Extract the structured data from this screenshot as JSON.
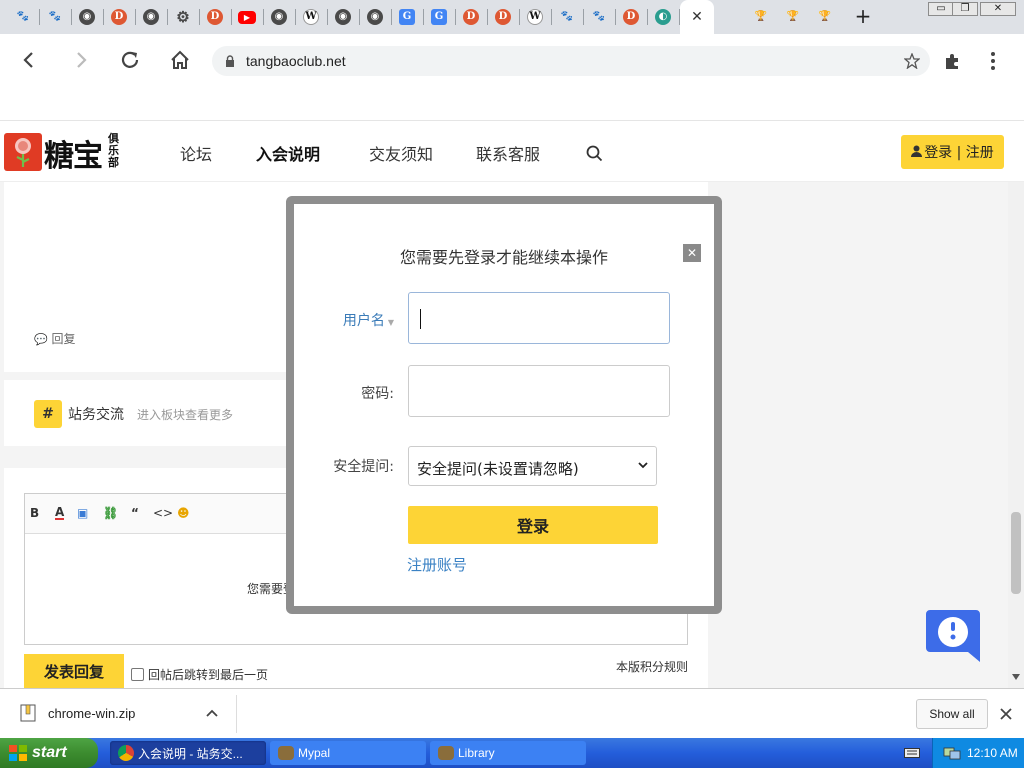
{
  "browser": {
    "tabs": [
      {
        "icon": "baidu-paw-icon",
        "color": "#2e5bd3",
        "glyph": "🐾"
      },
      {
        "icon": "baidu-paw-icon",
        "color": "#2e5bd3",
        "glyph": "🐾"
      },
      {
        "icon": "globe-icon",
        "color": "#4a4a4a",
        "glyph": "◉"
      },
      {
        "icon": "duckduckgo-icon",
        "color": "#de5833",
        "glyph": "D"
      },
      {
        "icon": "globe-icon",
        "color": "#4a4a4a",
        "glyph": "◉"
      },
      {
        "icon": "gear-icon",
        "color": "#4a4a4a",
        "glyph": "⚙"
      },
      {
        "icon": "duckduckgo-icon",
        "color": "#de5833",
        "glyph": "D"
      },
      {
        "icon": "youtube-icon",
        "color": "#ff0000",
        "glyph": "▶"
      },
      {
        "icon": "globe-icon",
        "color": "#4a4a4a",
        "glyph": "◉"
      },
      {
        "icon": "wikipedia-icon",
        "color": "#ffffff",
        "glyph": "W"
      },
      {
        "icon": "globe-icon",
        "color": "#4a4a4a",
        "glyph": "◉"
      },
      {
        "icon": "globe-icon",
        "color": "#4a4a4a",
        "glyph": "◉"
      },
      {
        "icon": "translate-icon",
        "color": "#4285f4",
        "glyph": "G"
      },
      {
        "icon": "translate-icon",
        "color": "#4285f4",
        "glyph": "G"
      },
      {
        "icon": "duckduckgo-icon",
        "color": "#de5833",
        "glyph": "D"
      },
      {
        "icon": "duckduckgo-icon",
        "color": "#de5833",
        "glyph": "D"
      },
      {
        "icon": "wikipedia-icon",
        "color": "#ffffff",
        "glyph": "W"
      },
      {
        "icon": "baidu-paw-icon",
        "color": "#2e5bd3",
        "glyph": "🐾"
      },
      {
        "icon": "baidu-paw-icon",
        "color": "#2e5bd3",
        "glyph": "🐾"
      },
      {
        "icon": "duckduckgo-icon",
        "color": "#de5833",
        "glyph": "D"
      },
      {
        "icon": "site-icon",
        "color": "#2a9d8f",
        "glyph": "◐"
      }
    ],
    "active_tab_close": "✕",
    "trailing_tabs": [
      {
        "icon": "trophy-icon",
        "color": "#f2b705",
        "glyph": "🏆"
      },
      {
        "icon": "trophy-icon",
        "color": "#f2b705",
        "glyph": "🏆"
      },
      {
        "icon": "trophy-icon",
        "color": "#f2b705",
        "glyph": "🏆"
      }
    ],
    "new_tab": "+",
    "window_buttons": [
      "▭",
      "❐",
      "✕"
    ],
    "url": "tangbaoclub.net"
  },
  "site": {
    "logo_main": "糖宝",
    "logo_small": "俱乐部",
    "nav": [
      "论坛",
      "入会说明",
      "交友须知",
      "联系客服"
    ],
    "login_register": "登录 | 注册",
    "login_icon": "👤"
  },
  "content": {
    "reply": "回复",
    "forum_hash": "#",
    "forum_name": "站务交流",
    "forum_hint": "进入板块查看更多",
    "editor_tools": [
      "B",
      "A",
      "▣",
      "⛓",
      "“",
      "<>",
      "☻"
    ],
    "editor_notice": "您需要登",
    "reply_button": "发表回复",
    "jump_label": "回帖后跳转到最后一页",
    "rules": "本版积分规则"
  },
  "modal": {
    "title": "您需要先登录才能继续本操作",
    "close": "✕",
    "username_label": "用户名",
    "username_value": "",
    "password_label": "密码:",
    "password_value": "",
    "security_label": "安全提问:",
    "security_selected": "安全提问(未设置请忽略)",
    "login": "登录",
    "register": "注册账号"
  },
  "downloads": {
    "file": "chrome-win.zip",
    "show_all": "Show all"
  },
  "taskbar": {
    "start": "start",
    "tasks": [
      "入会说明 - 站务交...",
      "Mypal",
      "Library"
    ],
    "time": "12:10 AM"
  }
}
